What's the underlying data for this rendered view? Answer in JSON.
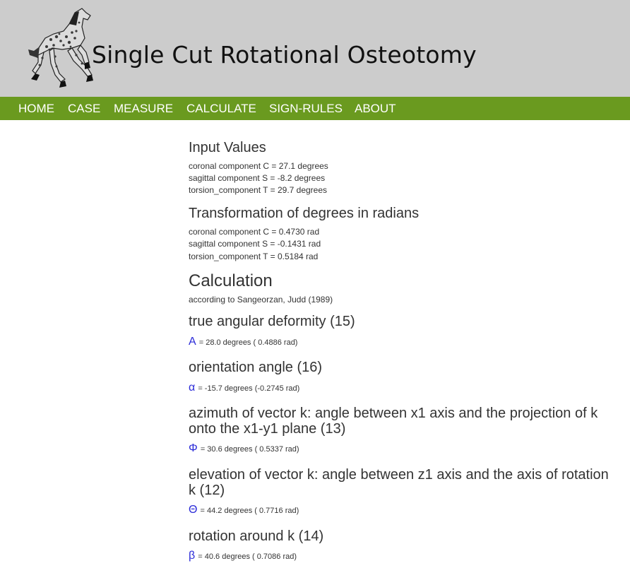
{
  "header": {
    "title": "Single Cut Rotational Osteotomy",
    "logo_icon": "horse-logo-icon"
  },
  "nav": {
    "items": [
      {
        "label": "HOME"
      },
      {
        "label": "CASE"
      },
      {
        "label": "MEASURE"
      },
      {
        "label": "CALCULATE"
      },
      {
        "label": "SIGN-RULES"
      },
      {
        "label": "ABOUT"
      }
    ]
  },
  "input_values": {
    "heading": "Input Values",
    "lines": [
      "coronal component C = 27.1 degrees",
      "sagittal component S = -8.2 degrees",
      "torsion_component T = 29.7 degrees"
    ]
  },
  "radians": {
    "heading": "Transformation of degrees in radians",
    "lines": [
      "coronal component C = 0.4730 rad",
      "sagittal component S = -0.1431 rad",
      "torsion_component T = 0.5184 rad"
    ]
  },
  "calculation": {
    "heading": "Calculation",
    "subheading": "according to Sangeorzan, Judd (1989)",
    "results": [
      {
        "title": "true angular deformity (15)",
        "symbol": "A",
        "value": "= 28.0 degrees ( 0.4886 rad)"
      },
      {
        "title": "orientation angle (16)",
        "symbol": "α",
        "value": "= -15.7 degrees (-0.2745 rad)"
      },
      {
        "title": "azimuth of vector k: angle between x1 axis and the projection of k onto the x1-y1 plane (13)",
        "symbol": "Φ",
        "value": "= 30.6 degrees ( 0.5337 rad)"
      },
      {
        "title": "elevation of vector k: angle between z1 axis and the axis of rotation k (12)",
        "symbol": "Θ",
        "value": "= 44.2 degrees ( 0.7716 rad)"
      },
      {
        "title": "rotation around k (14)",
        "symbol": "β",
        "value": "= 40.6 degrees ( 0.7086 rad)"
      }
    ]
  },
  "colors": {
    "banner": "#cccccc",
    "nav": "#6a9a1f",
    "symbol": "#2a2ad8"
  }
}
